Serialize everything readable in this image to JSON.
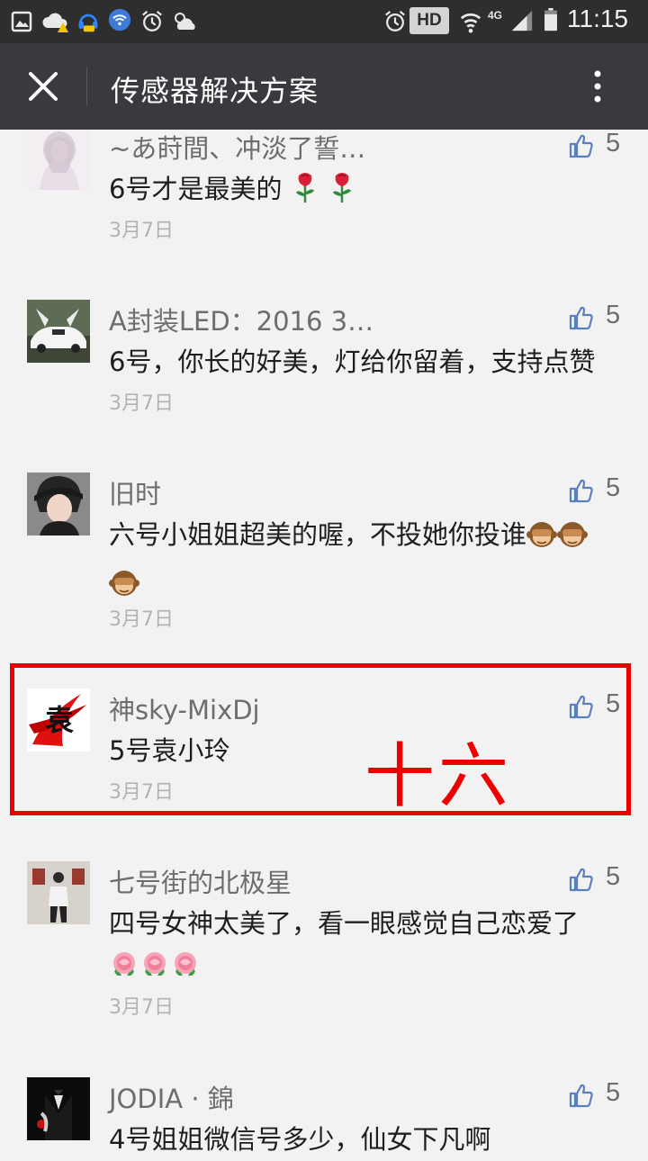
{
  "status_bar": {
    "hd_badge": "HD",
    "network": "4G",
    "time": "11:15"
  },
  "header": {
    "title": "传感器解决方案",
    "close_icon": "close-icon",
    "more_icon": "more-vertical-icon"
  },
  "comments": [
    {
      "nickname": "~あ莳間、冲淡了誓…",
      "text": "6号才是最美的",
      "emojis": [
        "rose",
        "rose"
      ],
      "date": "3月7日",
      "likes": "5"
    },
    {
      "nickname": "A封装LED：2016 3…",
      "text": "6号，你长的好美，灯给你留着，支持点赞",
      "date": "3月7日",
      "likes": "5"
    },
    {
      "nickname": "旧时",
      "text": "六号小姐姐超美的喔，不投她你投谁",
      "emojis": [
        "see-no-evil-monkey",
        "see-no-evil-monkey",
        "see-no-evil-monkey"
      ],
      "date": "3月7日",
      "likes": "5"
    },
    {
      "nickname": "神sky-MixDj",
      "text": "5号袁小玲",
      "date": "3月7日",
      "likes": "5"
    },
    {
      "nickname": "七号街的北极星",
      "text": "四号女神太美了，看一眼感觉自己恋爱了",
      "emojis": [
        "flower",
        "flower",
        "flower"
      ],
      "date": "3月7日",
      "likes": "5"
    },
    {
      "nickname": "JODIA · 錦",
      "text": "4号姐姐微信号多少，仙女下凡啊",
      "date": "",
      "likes": "5"
    }
  ],
  "annotation": {
    "text": "十六",
    "color": "#ee0000"
  },
  "colors": {
    "status_bar": "#2e2e2e",
    "title_bar": "#393a3e",
    "background": "#f2f2f2",
    "like_icon": "#5a7fbf"
  }
}
